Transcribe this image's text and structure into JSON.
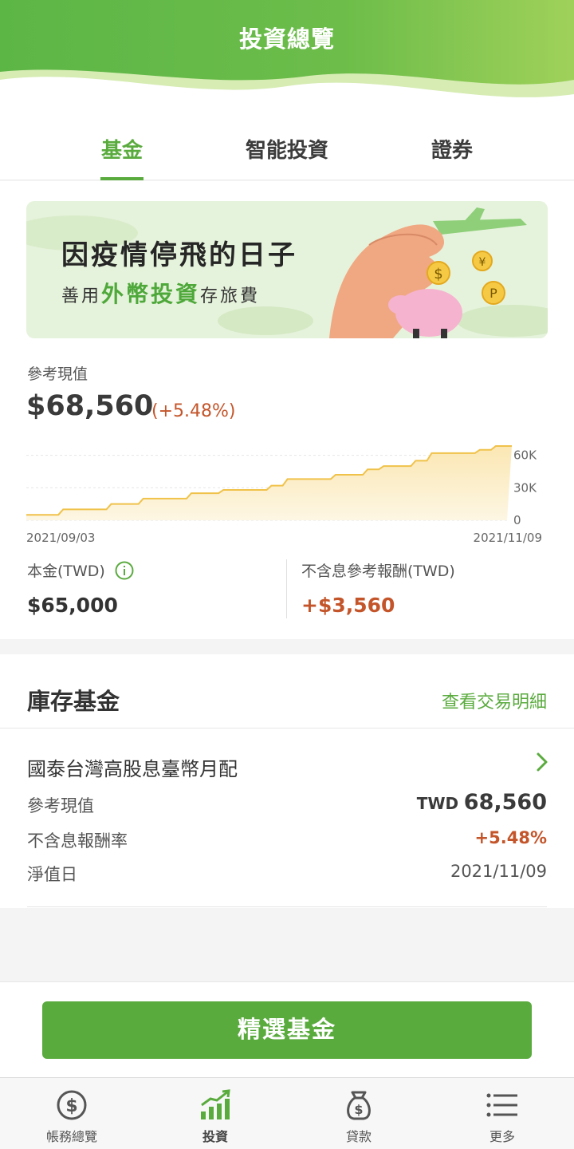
{
  "header": {
    "title": "投資總覽"
  },
  "tabs": [
    {
      "label": "基金",
      "active": true
    },
    {
      "label": "智能投資",
      "active": false
    },
    {
      "label": "證券",
      "active": false
    }
  ],
  "banner": {
    "line1": "因疫情停飛的日子",
    "line2_prefix": "善用",
    "line2_highlight": "外幣投資",
    "line2_suffix": "存旅費"
  },
  "summary": {
    "value_label": "參考現值",
    "value_amount": "$68,560",
    "value_change": "(+5.48%)",
    "principal_label": "本金(TWD)",
    "principal_value": "$65,000",
    "return_label": "不含息參考報酬(TWD)",
    "return_value": "+$3,560"
  },
  "chart_data": {
    "type": "area",
    "x_start_label": "2021/09/03",
    "x_end_label": "2021/11/09",
    "y_ticks": [
      "60K",
      "30K",
      "0"
    ],
    "ylim": [
      0,
      70000
    ],
    "values": [
      5000,
      5000,
      10000,
      10000,
      10000,
      15000,
      15000,
      20000,
      20000,
      20000,
      25000,
      25000,
      28000,
      28000,
      28000,
      32000,
      38000,
      38000,
      38000,
      42000,
      42000,
      47000,
      50000,
      50000,
      55000,
      62000,
      62000,
      62000,
      65000,
      68560,
      68560
    ]
  },
  "holdings": {
    "title": "庫存基金",
    "link": "查看交易明細",
    "fund": {
      "name": "國泰台灣高股息臺幣月配",
      "value_label": "參考現值",
      "value_currency": "TWD",
      "value_amount": "68,560",
      "return_label": "不含息報酬率",
      "return_value": "+5.48%",
      "nav_date_label": "淨值日",
      "nav_date_value": "2021/11/09"
    }
  },
  "cta": {
    "label": "精選基金"
  },
  "nav": [
    {
      "label": "帳務總覽",
      "icon": "dollar-circle-icon",
      "active": false
    },
    {
      "label": "投資",
      "icon": "growth-chart-icon",
      "active": true
    },
    {
      "label": "貸款",
      "icon": "money-bag-icon",
      "active": false
    },
    {
      "label": "更多",
      "icon": "menu-list-icon",
      "active": false
    }
  ],
  "colors": {
    "brand_green": "#5aab3e",
    "accent_orange": "#c4552a",
    "chart_line": "#f0c24a"
  }
}
